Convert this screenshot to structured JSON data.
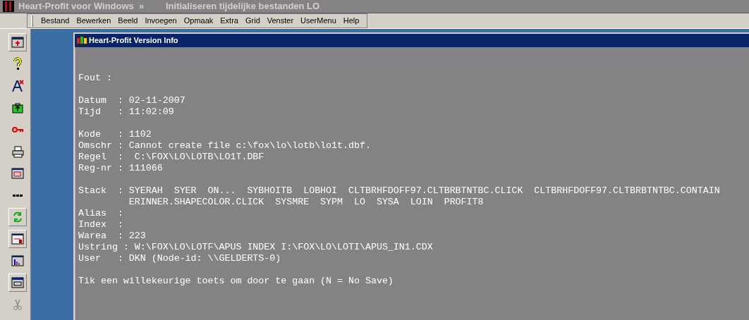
{
  "window": {
    "title": "Heart-Profit voor Windows  »",
    "status": "Initialiseren tijdelijke bestanden LO"
  },
  "menu": [
    "Bestand",
    "Bewerken",
    "Beeld",
    "Invoegen",
    "Opmaak",
    "Extra",
    "Grid",
    "Venster",
    "UserMenu",
    "Help"
  ],
  "dialog": {
    "title": "Heart-Profit Version Info",
    "sections": [
      [
        "Fout :"
      ],
      [
        "Datum  : 02-11-2007",
        "Tijd   : 11:02:09"
      ],
      [
        "Kode   : 1102",
        "Omschr : Cannot create file c:\\fox\\lo\\lotb\\lo1t.dbf.",
        "Regel  :  C:\\FOX\\LO\\LOTB\\LO1T.DBF",
        "Reg-nr : 111066"
      ],
      [
        "Stack  : SYERAH  SYER  ON...  SYBHOITB  LOBHOI  CLTBRHFDOFF97.CLTBRBTNTBC.CLICK  CLTBRHFDOFF97.CLTBRBTNTBC.CONTAIN",
        "         ERINNER.SHAPECOLOR.CLICK  SYSMRE  SYPM  LO  SYSA  LOIN  PROFIT8",
        "Alias  :",
        "Index  :",
        "Warea  : 223",
        "Ustring : W:\\FOX\\LO\\LOTF\\APUS INDEX I:\\FOX\\LO\\LOTI\\APUS_IN1.CDX",
        "User   : DKN (Node-id: \\\\GELDERTS-0)"
      ],
      [
        "Tik een willekeurige toets om door te gaan (N = No Save)"
      ]
    ]
  }
}
